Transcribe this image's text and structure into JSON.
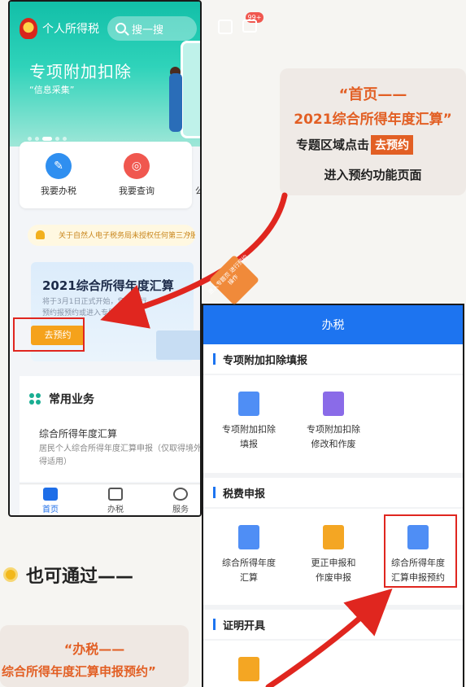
{
  "phone1": {
    "app_title": "个人所得税",
    "search_placeholder": "搜一搜",
    "badge": "99+",
    "banner_title": "专项附加扣除",
    "banner_sub": "“信息采集”",
    "quick": [
      {
        "label": "我要办税",
        "color": "#2f8ff0"
      },
      {
        "label": "我要查询",
        "color": "#f0574f"
      },
      {
        "label": "公众服务",
        "color": "#27b88f"
      }
    ],
    "notice": "关于自然人电子税务局未授权任何第三方服...",
    "annual_title": "2021综合所得年度汇算",
    "annual_desc": "将于3月1日正式开始，您可进行预约报预约或进入专题页面",
    "corner_tag": "进入专题页 进行预约操作",
    "go_button": "去预约",
    "common_title": "常用业务",
    "common_item": "综合所得年度汇算",
    "common_item_desc": "居民个人综合所得年度汇算申报（仅取得境外所得适用）",
    "tabs": [
      "首页",
      "办税",
      "服务"
    ]
  },
  "note1": {
    "line1": "“首页——",
    "line2": "2021综合所得年度汇算”",
    "line3_pre": "专题区域点击",
    "line3_tag": "去预约",
    "line4": "进入预约功能页面"
  },
  "phone2": {
    "header": "办税",
    "sections": [
      {
        "title": "专项附加扣除填报",
        "items": [
          "专项附加扣除\n填报",
          "专项附加扣除\n修改和作废"
        ]
      },
      {
        "title": "税费申报",
        "items": [
          "综合所得年度\n汇算",
          "更正申报和\n作废申报",
          "综合所得年度\n汇算申报预约"
        ]
      },
      {
        "title": "证明开具",
        "items": []
      }
    ]
  },
  "also": "也可通过——",
  "note2": {
    "line1": "“办税——",
    "line2": "综合所得年度汇算申报预约”"
  },
  "colors": {
    "accent": "#e25f24",
    "brand_blue": "#1d74f0",
    "teal": "#12bfa8"
  }
}
